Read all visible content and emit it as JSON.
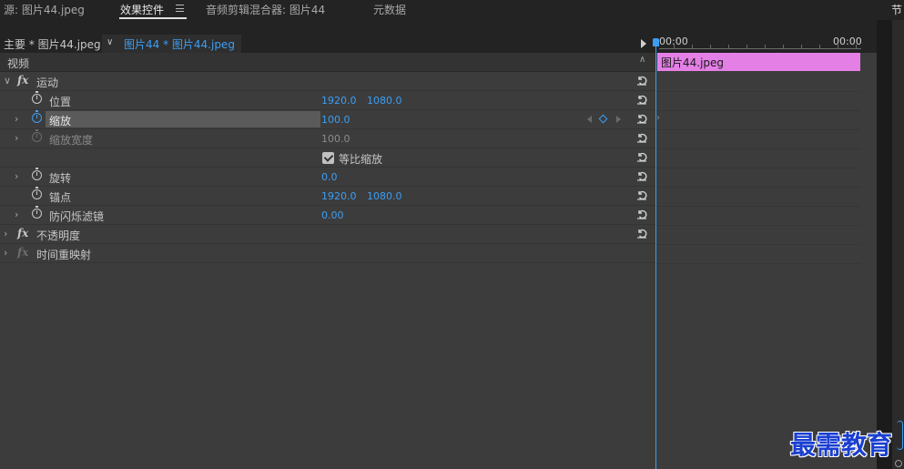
{
  "tabs": [
    {
      "label": "源: 图片44.jpeg"
    },
    {
      "label": "效果控件"
    },
    {
      "label": "音频剪辑混合器: 图片44"
    },
    {
      "label": "元数据"
    }
  ],
  "right_panel_label": "节",
  "sequence": {
    "master_label": "主要 * 图片44.jpeg",
    "clip_label": "图片44 * 图片44.jpeg"
  },
  "timeline": {
    "time_start": "00:00",
    "time_end": "00:00",
    "clip_name": "图片44.jpeg"
  },
  "effects": {
    "section_header": "视频",
    "motion": {
      "label": "运动",
      "position": {
        "label": "位置",
        "x": "1920.0",
        "y": "1080.0"
      },
      "scale": {
        "label": "缩放",
        "value": "100.0"
      },
      "scale_width": {
        "label": "缩放宽度",
        "value": "100.0"
      },
      "uniform_scale": {
        "label": "等比缩放",
        "checked": true
      },
      "rotation": {
        "label": "旋转",
        "value": "0.0"
      },
      "anchor": {
        "label": "锚点",
        "x": "1920.0",
        "y": "1080.0"
      },
      "anti_flicker": {
        "label": "防闪烁滤镜",
        "value": "0.00"
      }
    },
    "opacity": {
      "label": "不透明度"
    },
    "time_remap": {
      "label": "时间重映射"
    }
  },
  "watermark": "最需教育",
  "colors": {
    "accent_blue": "#3d9ef3",
    "clip_pink": "#e47fe6",
    "panel_bg": "#3c3c3c"
  },
  "icons": {
    "stopwatch": "stopwatch-icon",
    "reset": "reset-icon",
    "fx": "fx-icon"
  }
}
